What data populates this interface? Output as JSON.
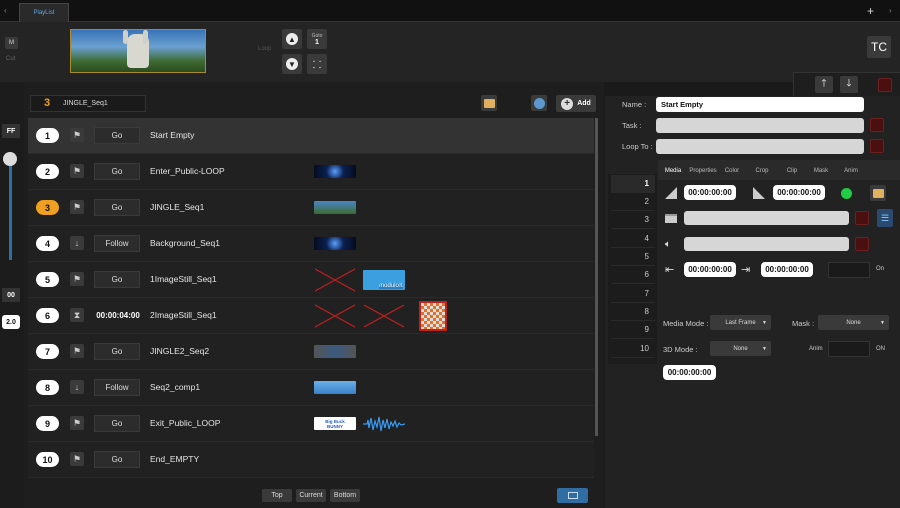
{
  "tab": {
    "label": "PlayList"
  },
  "header": {
    "plus": "+",
    "tc_label": "TC",
    "goto_label": "Goto",
    "goto_value": "1",
    "m_label": "M",
    "cut_label": "Cut",
    "loop_label": "Loop"
  },
  "left": {
    "ff_label": "FF",
    "zero_label": "00",
    "speed_value": "2.0"
  },
  "toolbar": {
    "current_num": "3",
    "current_name": "JINGLE_Seq1",
    "add_label": "Add"
  },
  "rows": [
    {
      "num": "1",
      "trigger": "Go",
      "name": "Start Empty"
    },
    {
      "num": "2",
      "trigger": "Go",
      "name": "Enter_Public-LOOP"
    },
    {
      "num": "3",
      "trigger": "Go",
      "name": "JINGLE_Seq1"
    },
    {
      "num": "4",
      "trigger": "Follow",
      "name": "Background_Seq1"
    },
    {
      "num": "5",
      "trigger": "Go",
      "name": "1ImageStill_Seq1",
      "thumb_text": "moduloπ"
    },
    {
      "num": "6",
      "trigger": "00:00:04:00",
      "name": "2ImageStill_Seq1"
    },
    {
      "num": "7",
      "trigger": "Go",
      "name": "JINGLE2_Seq2"
    },
    {
      "num": "8",
      "trigger": "Follow",
      "name": "Seq2_comp1"
    },
    {
      "num": "9",
      "trigger": "Go",
      "name": "Exit_Public_LOOP",
      "thumb_text": "Big Buck BUNNY"
    },
    {
      "num": "10",
      "trigger": "Go",
      "name": "End_EMPTY"
    }
  ],
  "bottom": {
    "top_label": "Top",
    "current_label": "Current",
    "bottom_label": "Bottom"
  },
  "props": {
    "name_label": "Name :",
    "name_value": "Start Empty",
    "task_label": "Task :",
    "loopto_label": "Loop To :",
    "tabs": [
      "Media",
      "Properties",
      "Color",
      "Crop",
      "Clip",
      "Mask",
      "Anim"
    ],
    "layers": [
      "1",
      "2",
      "3",
      "4",
      "5",
      "6",
      "7",
      "8",
      "9",
      "10"
    ],
    "tc_in": "00:00:00:00",
    "tc_out": "00:00:00:00",
    "clip_in": "00:00:00:00",
    "clip_out": "00:00:00:00",
    "on_label_1": "On",
    "media_mode_label": "Media Mode :",
    "media_mode_value": "Last Frame",
    "mask_label": "Mask :",
    "mask_value": "None",
    "mode3d_label": "3D Mode :",
    "mode3d_value": "None",
    "anim_label": "Anim",
    "on_label_2": "ON",
    "tc_bottom": "00:00:00:00"
  },
  "colors": {
    "accent": "#f0a020",
    "status_green": "#22cc44",
    "selected_tab": "#2f6da3"
  }
}
